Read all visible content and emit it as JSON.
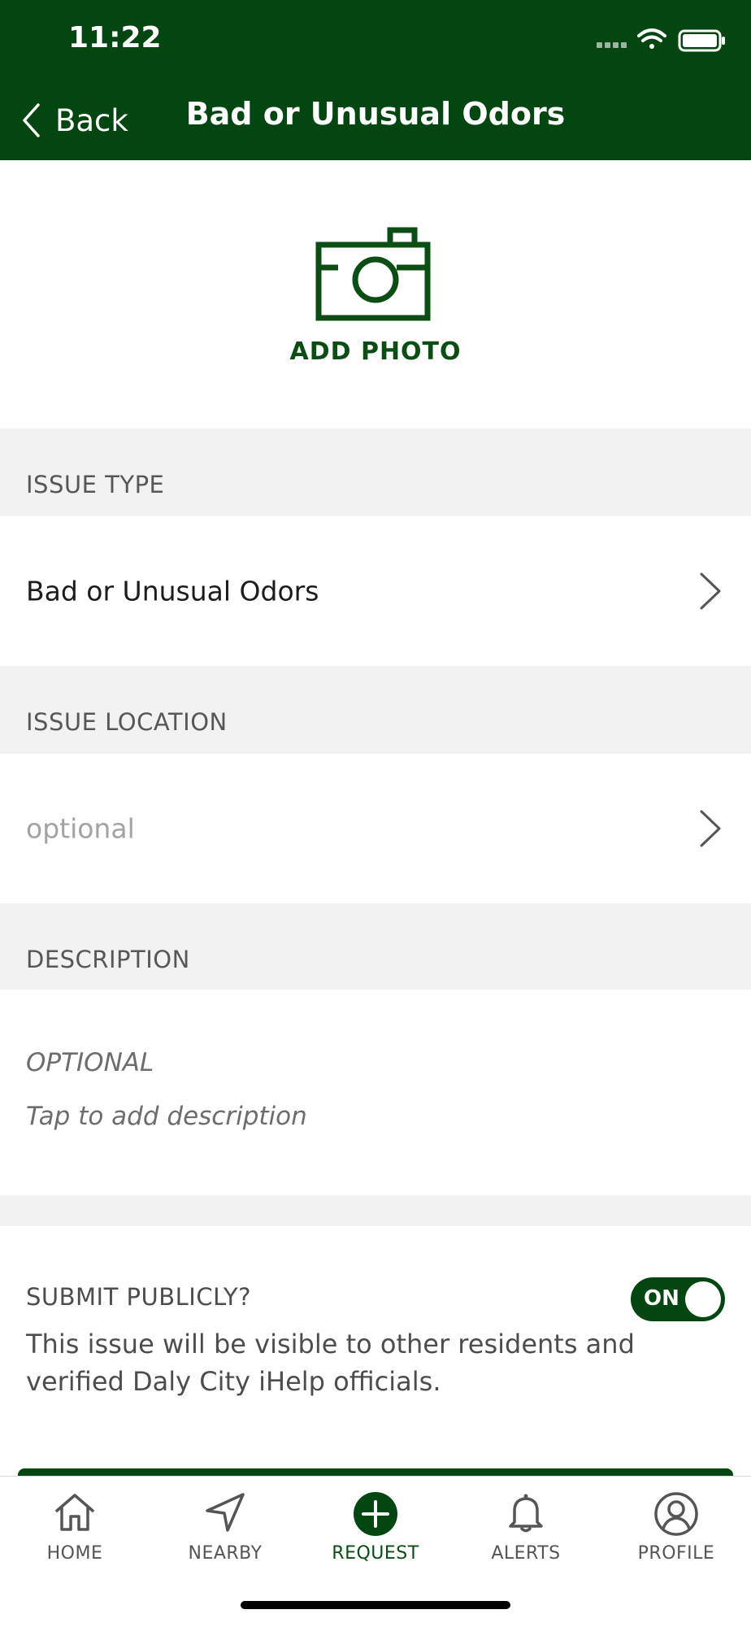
{
  "status_bar": {
    "time": "11:22",
    "icons": [
      "signal-icon",
      "wifi-icon",
      "battery-icon"
    ]
  },
  "nav": {
    "back_label": "Back",
    "title": "Bad or Unusual Odors"
  },
  "photo": {
    "label": "ADD PHOTO",
    "icon": "camera-icon"
  },
  "issue_type": {
    "header": "ISSUE TYPE",
    "value": "Bad or Unusual Odors"
  },
  "issue_location": {
    "header": "ISSUE LOCATION",
    "placeholder": "optional"
  },
  "description": {
    "header": "DESCRIPTION",
    "optional_label": "OPTIONAL",
    "placeholder": "Tap to add description"
  },
  "submit_publicly": {
    "title": "SUBMIT PUBLICLY?",
    "text": "This issue will be visible to other residents and verified Daly City iHelp officials.",
    "toggle_label": "ON",
    "toggle_on": true
  },
  "tabs": [
    {
      "label": "HOME",
      "icon": "home-icon"
    },
    {
      "label": "NEARBY",
      "icon": "location-arrow-icon"
    },
    {
      "label": "REQUEST",
      "icon": "plus-circle-icon"
    },
    {
      "label": "ALERTS",
      "icon": "bell-icon"
    },
    {
      "label": "PROFILE",
      "icon": "profile-icon"
    }
  ],
  "colors": {
    "brand_green": "#044611",
    "section_bg": "#f2f2f2",
    "text_gray": "#575757"
  }
}
